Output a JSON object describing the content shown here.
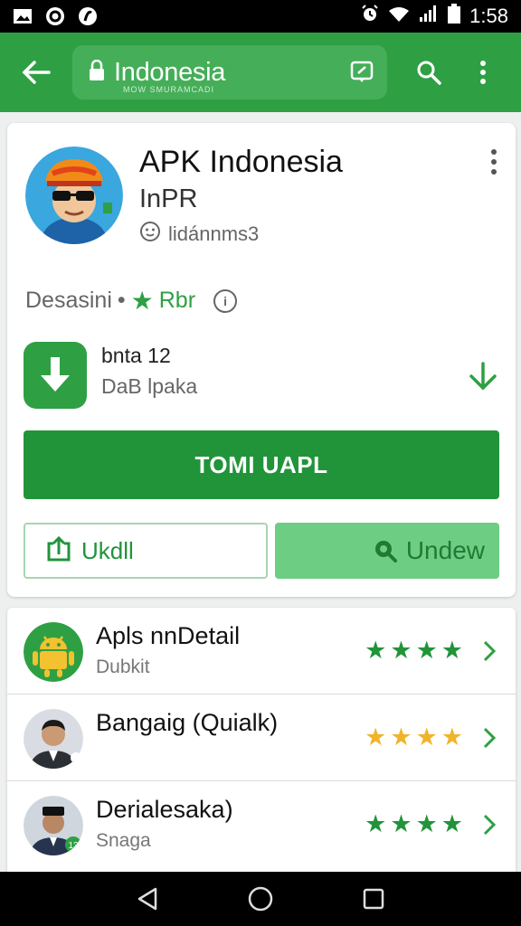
{
  "status_bar": {
    "time": "1:58",
    "left_icons": [
      "image-icon",
      "circle-notification-icon",
      "circle-notification-icon"
    ],
    "right_icons": [
      "alarm-icon",
      "wifi-icon",
      "signal-icon",
      "battery-icon"
    ]
  },
  "toolbar": {
    "title": "Indonesia",
    "subtitle": "MOW SMURAMCADI",
    "icons": [
      "back-arrow-icon",
      "lock-icon",
      "edit-icon",
      "search-icon",
      "more-vert-icon"
    ]
  },
  "app": {
    "name": "APK Indonesia",
    "developer": "InPR",
    "meta": "lidánnms3",
    "rating_label": "Desasini",
    "separator": "•",
    "rank": "Rbr",
    "info_glyph": "i",
    "download": {
      "title": "bnta 12",
      "subtitle": "DaB lpaka"
    },
    "install_label": "TOMI UAPL",
    "left_button_label": "Ukdll",
    "right_button_label": "Undew"
  },
  "list": [
    {
      "title": "Apls nnDetail",
      "subtitle": "Dubkit",
      "stars": 4,
      "star_color": "#21943a",
      "avatar": "android-icon"
    },
    {
      "title": "Bangaig (Quialk)",
      "subtitle": "",
      "stars": 4,
      "star_color": "#f0b429",
      "avatar": "person-photo"
    },
    {
      "title": "Derialesaka)",
      "subtitle": "Snaga",
      "stars": 4,
      "star_color": "#21943a",
      "avatar": "person-photo"
    }
  ],
  "colors": {
    "primary": "#2ea043",
    "primary_dark": "#21943a",
    "accent_soft": "#6ccd83",
    "star_gold": "#f0b429"
  },
  "nav_icons": [
    "back-triangle-icon",
    "home-circle-icon",
    "recents-square-icon"
  ]
}
